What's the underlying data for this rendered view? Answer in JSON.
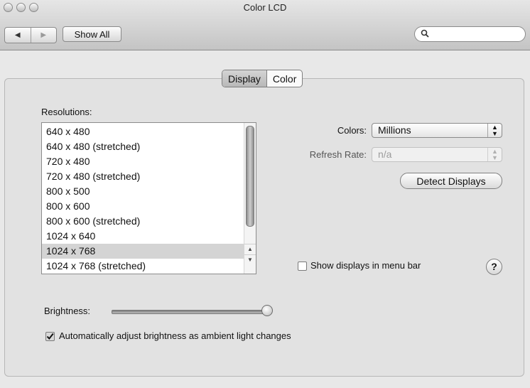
{
  "window": {
    "title": "Color LCD"
  },
  "toolbar": {
    "back_icon": "◀",
    "forward_icon": "▶",
    "show_all_label": "Show All",
    "search_icon": "🔍",
    "search_value": "",
    "search_placeholder": ""
  },
  "tabs": [
    {
      "label": "Display",
      "selected": true
    },
    {
      "label": "Color",
      "selected": false
    }
  ],
  "resolutions": {
    "label": "Resolutions:",
    "items": [
      "640 x 480",
      "640 x 480 (stretched)",
      "720 x 480",
      "720 x 480 (stretched)",
      "800 x 500",
      "800 x 600",
      "800 x 600 (stretched)",
      "1024 x 640",
      "1024 x 768",
      "1024 x 768 (stretched)"
    ],
    "selected": "1024 x 768"
  },
  "colors": {
    "label": "Colors:",
    "value": "Millions"
  },
  "refresh_rate": {
    "label": "Refresh Rate:",
    "value": "n/a"
  },
  "detect_displays_label": "Detect Displays",
  "show_displays_in_menu_bar": {
    "label": "Show displays in menu bar",
    "checked": false
  },
  "help_label": "?",
  "brightness": {
    "label": "Brightness:",
    "level": 1.0
  },
  "auto_brightness": {
    "label": "Automatically adjust brightness as ambient light changes",
    "checked": true
  }
}
